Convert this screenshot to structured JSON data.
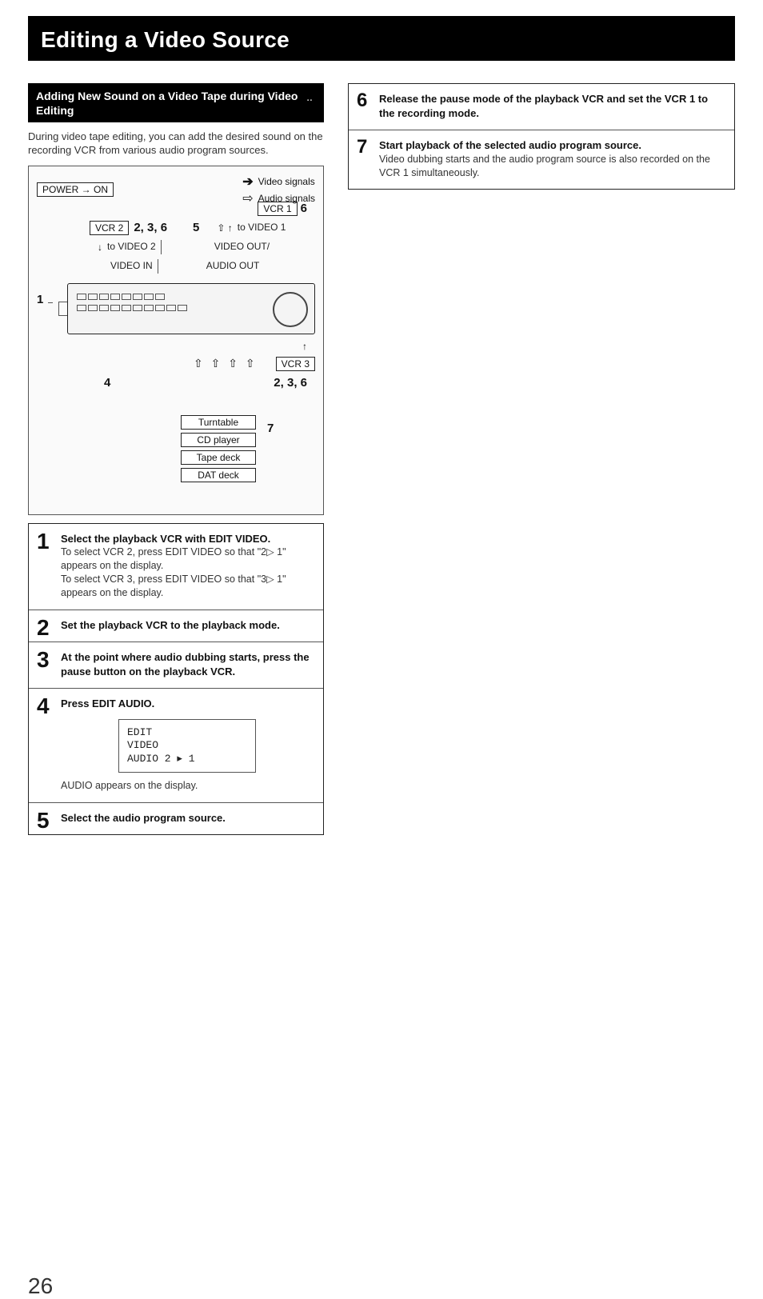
{
  "title": "Editing a Video Source",
  "subtitle": "Adding New Sound on a Video Tape during Video Editing",
  "intro": "During video tape editing, you can add the desired sound on the recording VCR from various audio program sources.",
  "legend": {
    "video": "Video signals",
    "audio": "Audio signals"
  },
  "diagram": {
    "power": "POWER → ON",
    "vcr1": "VCR 1",
    "vcr1_step": "6",
    "to_video1": "to VIDEO 1",
    "video_out": "VIDEO OUT/",
    "audio_out": "AUDIO OUT",
    "vcr2": "VCR 2",
    "vcr2_steps": "2, 3, 6",
    "col_5": "5",
    "to_video2": "to VIDEO 2",
    "video_in": "VIDEO IN",
    "row1_num": "1",
    "row4_num": "4",
    "vcr3": "VCR 3",
    "vcr3_steps": "2, 3, 6",
    "seven": "7",
    "sources": [
      "Turntable",
      "CD player",
      "Tape deck",
      "DAT deck"
    ]
  },
  "steps": {
    "s1": {
      "heading": "Select the playback VCR with EDIT VIDEO.",
      "line1": "To select VCR 2, press EDIT VIDEO so that \"2▷ 1\" appears on the display.",
      "line2": "To select VCR 3, press EDIT VIDEO so that \"3▷ 1\" appears on the display."
    },
    "s2": {
      "heading": "Set the playback VCR to the playback mode."
    },
    "s3": {
      "heading": "At the point where audio dubbing starts, press the pause button on the playback VCR."
    },
    "s4": {
      "heading": "Press EDIT AUDIO.",
      "lcd_l1": "EDIT",
      "lcd_l2": "VIDEO",
      "lcd_l3": "AUDIO   2 ▸ 1",
      "note": "AUDIO appears on the display."
    },
    "s5": {
      "heading": "Select the audio program source."
    },
    "s6": {
      "heading": "Release the pause mode of the playback VCR and set the VCR 1 to the recording mode."
    },
    "s7": {
      "heading": "Start playback of the selected audio program source.",
      "note": "Video dubbing starts and the audio program source is also recorded on the VCR 1 simultaneously."
    }
  },
  "page_number": "26"
}
